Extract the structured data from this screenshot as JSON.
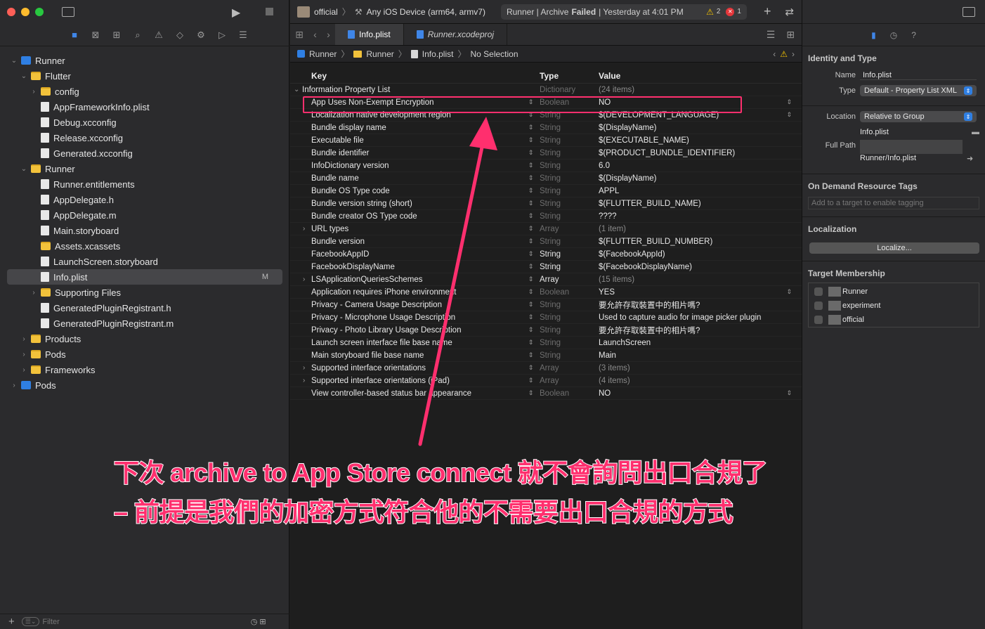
{
  "toolbar": {
    "scheme_name": "official",
    "destination": "Any iOS Device (arm64, armv7)",
    "activity": "Runner | Archive ",
    "activity_bold": "Failed",
    "activity_time": " | Yesterday at 4:01 PM",
    "warning_count": "2",
    "error_count": "1"
  },
  "navigator": {
    "items": [
      {
        "label": "Runner",
        "indent": 0,
        "disc": "v",
        "icon": "proj"
      },
      {
        "label": "Flutter",
        "indent": 1,
        "disc": "v",
        "icon": "folder"
      },
      {
        "label": "config",
        "indent": 2,
        "disc": ">",
        "icon": "folder"
      },
      {
        "label": "AppFrameworkInfo.plist",
        "indent": 2,
        "disc": "",
        "icon": "doc"
      },
      {
        "label": "Debug.xcconfig",
        "indent": 2,
        "disc": "",
        "icon": "doc"
      },
      {
        "label": "Release.xcconfig",
        "indent": 2,
        "disc": "",
        "icon": "doc"
      },
      {
        "label": "Generated.xcconfig",
        "indent": 2,
        "disc": "",
        "icon": "doc"
      },
      {
        "label": "Runner",
        "indent": 1,
        "disc": "v",
        "icon": "folder"
      },
      {
        "label": "Runner.entitlements",
        "indent": 2,
        "disc": "",
        "icon": "doc"
      },
      {
        "label": "AppDelegate.h",
        "indent": 2,
        "disc": "",
        "icon": "doc"
      },
      {
        "label": "AppDelegate.m",
        "indent": 2,
        "disc": "",
        "icon": "doc"
      },
      {
        "label": "Main.storyboard",
        "indent": 2,
        "disc": "",
        "icon": "doc"
      },
      {
        "label": "Assets.xcassets",
        "indent": 2,
        "disc": "",
        "icon": "folder"
      },
      {
        "label": "LaunchScreen.storyboard",
        "indent": 2,
        "disc": "",
        "icon": "doc"
      },
      {
        "label": "Info.plist",
        "indent": 2,
        "disc": "",
        "icon": "doc",
        "selected": true,
        "badge": "M"
      },
      {
        "label": "Supporting Files",
        "indent": 2,
        "disc": ">",
        "icon": "folder"
      },
      {
        "label": "GeneratedPluginRegistrant.h",
        "indent": 2,
        "disc": "",
        "icon": "doc"
      },
      {
        "label": "GeneratedPluginRegistrant.m",
        "indent": 2,
        "disc": "",
        "icon": "doc"
      },
      {
        "label": "Products",
        "indent": 1,
        "disc": ">",
        "icon": "folder"
      },
      {
        "label": "Pods",
        "indent": 1,
        "disc": ">",
        "icon": "folder"
      },
      {
        "label": "Frameworks",
        "indent": 1,
        "disc": ">",
        "icon": "folder"
      },
      {
        "label": "Pods",
        "indent": 0,
        "disc": ">",
        "icon": "proj"
      }
    ],
    "filter_placeholder": "Filter"
  },
  "tabs": [
    {
      "label": "Info.plist",
      "active": true
    },
    {
      "label": "Runner.xcodeproj",
      "active": false
    }
  ],
  "jumpbar": {
    "items": [
      "Runner",
      "Runner",
      "Info.plist",
      "No Selection"
    ]
  },
  "plist": {
    "headers": {
      "key": "Key",
      "type": "Type",
      "value": "Value"
    },
    "rows": [
      {
        "key": "Information Property List",
        "type": "Dictionary",
        "value": "(24 items)",
        "root": true
      },
      {
        "key": "App Uses Non-Exempt Encryption",
        "type": "Boolean",
        "value": "NO",
        "step": true
      },
      {
        "key": "Localization native development region",
        "type": "String",
        "value": "$(DEVELOPMENT_LANGUAGE)",
        "step": true
      },
      {
        "key": "Bundle display name",
        "type": "String",
        "value": "$(DisplayName)"
      },
      {
        "key": "Executable file",
        "type": "String",
        "value": "$(EXECUTABLE_NAME)"
      },
      {
        "key": "Bundle identifier",
        "type": "String",
        "value": "$(PRODUCT_BUNDLE_IDENTIFIER)"
      },
      {
        "key": "InfoDictionary version",
        "type": "String",
        "value": "6.0"
      },
      {
        "key": "Bundle name",
        "type": "String",
        "value": "$(DisplayName)"
      },
      {
        "key": "Bundle OS Type code",
        "type": "String",
        "value": "APPL"
      },
      {
        "key": "Bundle version string (short)",
        "type": "String",
        "value": "$(FLUTTER_BUILD_NAME)"
      },
      {
        "key": "Bundle creator OS Type code",
        "type": "String",
        "value": "????"
      },
      {
        "key": "URL types",
        "type": "Array",
        "value": "(1 item)",
        "disc": true
      },
      {
        "key": "Bundle version",
        "type": "String",
        "value": "$(FLUTTER_BUILD_NUMBER)"
      },
      {
        "key": "FacebookAppID",
        "type": "String",
        "value": "$(FacebookAppId)",
        "bright": true
      },
      {
        "key": "FacebookDisplayName",
        "type": "String",
        "value": "$(FacebookDisplayName)",
        "bright": true
      },
      {
        "key": "LSApplicationQueriesSchemes",
        "type": "Array",
        "value": "(15 items)",
        "disc": true,
        "bright": true
      },
      {
        "key": "Application requires iPhone environment",
        "type": "Boolean",
        "value": "YES",
        "step": true
      },
      {
        "key": "Privacy - Camera Usage Description",
        "type": "String",
        "value": "要允許存取裝置中的相片嗎?"
      },
      {
        "key": "Privacy - Microphone Usage Description",
        "type": "String",
        "value": "Used to capture audio for image picker plugin"
      },
      {
        "key": "Privacy - Photo Library Usage Description",
        "type": "String",
        "value": "要允許存取裝置中的相片嗎?"
      },
      {
        "key": "Launch screen interface file base name",
        "type": "String",
        "value": "LaunchScreen"
      },
      {
        "key": "Main storyboard file base name",
        "type": "String",
        "value": "Main"
      },
      {
        "key": "Supported interface orientations",
        "type": "Array",
        "value": "(3 items)",
        "disc": true
      },
      {
        "key": "Supported interface orientations (iPad)",
        "type": "Array",
        "value": "(4 items)",
        "disc": true
      },
      {
        "key": "View controller-based status bar appearance",
        "type": "Boolean",
        "value": "NO",
        "step": true
      }
    ]
  },
  "inspector": {
    "identity_title": "Identity and Type",
    "name_label": "Name",
    "name_value": "Info.plist",
    "type_label": "Type",
    "type_value": "Default - Property List XML",
    "location_label": "Location",
    "location_value": "Relative to Group",
    "location_file": "Info.plist",
    "fullpath_label": "Full Path",
    "fullpath_value": "Runner/Info.plist",
    "odr_title": "On Demand Resource Tags",
    "odr_placeholder": "Add to a target to enable tagging",
    "localization_title": "Localization",
    "localize_button": "Localize...",
    "membership_title": "Target Membership",
    "targets": [
      "Runner",
      "experiment",
      "official"
    ]
  },
  "annotation": {
    "line1": "下次 archive to App Store connect 就不會詢問出口合規了",
    "line2": "– 前提是我們的加密方式符合他的不需要出口合規的方式",
    "color": "#ff2f6e"
  }
}
